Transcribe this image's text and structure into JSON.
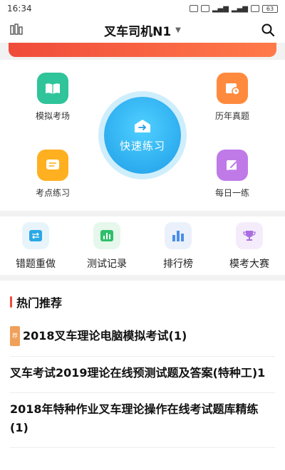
{
  "status_bar": {
    "time": "16:34",
    "battery": "63"
  },
  "header": {
    "title": "叉车司机N1"
  },
  "practice": {
    "mock_exam": "模拟考场",
    "past_papers": "历年真题",
    "quick_practice": "快速练习",
    "point_practice": "考点练习",
    "daily_practice": "每日一练"
  },
  "tools": [
    {
      "label": "错题重做"
    },
    {
      "label": "测试记录"
    },
    {
      "label": "排行榜"
    },
    {
      "label": "模考大赛"
    }
  ],
  "recommend": {
    "title": "热门推荐",
    "tag": "荐",
    "items": [
      {
        "text": "2018叉车理论电脑模拟考试(1)"
      },
      {
        "text": "叉车考试2019理论在线预测试题及答案(特种工)1"
      },
      {
        "text": "2018年特种作业叉车理论操作在线考试题库精练(1)"
      }
    ]
  },
  "colors": {
    "accent_blue": "#1f9de8",
    "banner_red": "#f04b3a",
    "mock_green": "#2fc49a",
    "past_orange": "#ff8a3d",
    "point_yellow": "#ffb020",
    "daily_purple": "#c07ae8"
  }
}
